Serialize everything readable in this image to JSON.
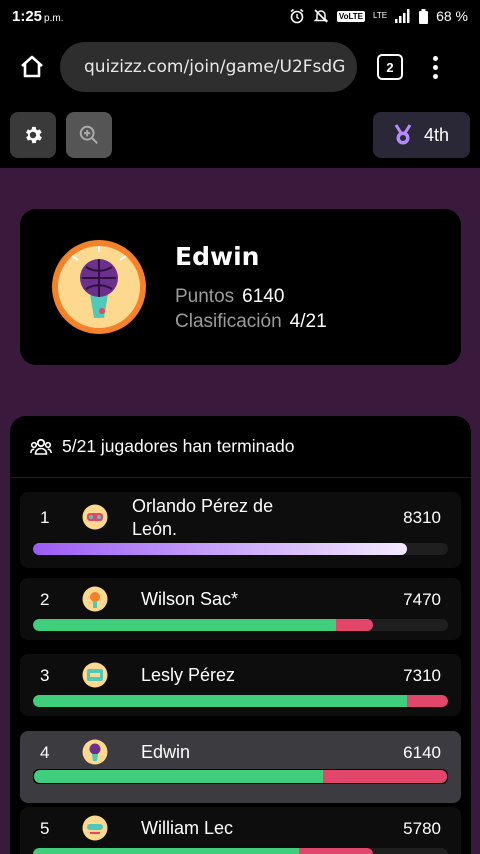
{
  "status": {
    "time": "1:25",
    "ampm": "p.m.",
    "volte": "VoLTE",
    "lte": "LTE",
    "battery": "68 %"
  },
  "browser": {
    "url": "quizizz.com/join/game/U2FsdG",
    "tab_count": "2"
  },
  "game": {
    "rank_label": "4th"
  },
  "player": {
    "name": "Edwin",
    "points_label": "Puntos",
    "points_value": "6140",
    "rank_label": "Clasificación",
    "rank_value": "4/21"
  },
  "leaderboard": {
    "header": "5/21 jugadores han terminado",
    "entries": [
      {
        "rank": "1",
        "name_line1": "Orlando Pérez de",
        "name_line2": "León.",
        "score": "8310",
        "correct": 0.9,
        "incorrect": 0.0,
        "style": "purple"
      },
      {
        "rank": "2",
        "name": "Wilson Sac*",
        "score": "7470",
        "correct": 0.73,
        "incorrect": 0.09
      },
      {
        "rank": "3",
        "name": "Lesly Pérez",
        "score": "7310",
        "correct": 0.9,
        "incorrect": 0.1
      },
      {
        "rank": "4",
        "name": "Edwin",
        "score": "6140",
        "correct": 0.7,
        "incorrect": 0.3,
        "me": true
      },
      {
        "rank": "5",
        "name": "William Lec",
        "score": "5780",
        "correct": 0.64,
        "incorrect": 0.18
      }
    ]
  },
  "colors": {
    "background": "#3a1a3c",
    "correct": "#3fcf7c",
    "incorrect": "#e2466a",
    "leader_gradient_start": "#9b5cf6",
    "leader_gradient_end": "#f4e9ff"
  }
}
